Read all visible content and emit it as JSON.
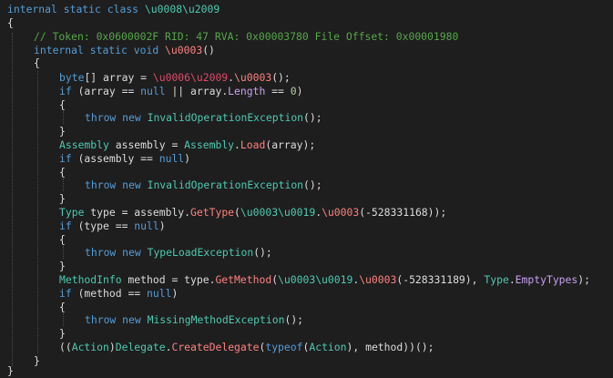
{
  "code": {
    "class_decl": {
      "kw1": "internal",
      "kw2": "static",
      "kw3": "class",
      "name": "\\u0008\\u2009"
    },
    "open_brace_1": "{",
    "comment": "// Token: 0x0600002F RID: 47 RVA: 0x00003780 File Offset: 0x00001980",
    "method_decl": {
      "kw1": "internal",
      "kw2": "static",
      "kw3": "void",
      "name": "\\u0003",
      "parens": "()"
    },
    "open_brace_2": "{",
    "l1": {
      "type": "byte",
      "rest1": "[] array = ",
      "obj": "\\u0006\\u2009",
      "dot": ".",
      "meth": "\\u0003",
      "end": "();"
    },
    "l2": {
      "kw": "if",
      "p1": " (array == ",
      "null": "null",
      "p2": " || array.",
      "prop": "Length",
      "p3": " == ",
      "num": "0",
      "p4": ")"
    },
    "l3": "{",
    "l4": {
      "kw1": "throw",
      "kw2": "new",
      "type": "InvalidOperationException",
      "end": "();"
    },
    "l5": "}",
    "l6": {
      "type1": "Assembly",
      "p1": " assembly = ",
      "type2": "Assembly",
      "dot": ".",
      "meth": "Load",
      "end": "(array);"
    },
    "l7": {
      "kw": "if",
      "p1": " (assembly == ",
      "null": "null",
      "p2": ")"
    },
    "l8": "{",
    "l9": {
      "kw1": "throw",
      "kw2": "new",
      "type": "InvalidOperationException",
      "end": "();"
    },
    "l10": "}",
    "l11": {
      "type1": "Type",
      "p1": " type = assembly.",
      "meth": "GetType",
      "p2": "(",
      "obj": "\\u0003\\u0019",
      "dot": ".",
      "meth2": "\\u0003",
      "end": "(-528331168));"
    },
    "l12": {
      "kw": "if",
      "p1": " (type == ",
      "null": "null",
      "p2": ")"
    },
    "l13": "{",
    "l14": {
      "kw1": "throw",
      "kw2": "new",
      "type": "TypeLoadException",
      "end": "();"
    },
    "l15": "}",
    "l16": {
      "type1": "MethodInfo",
      "p1": " method = type.",
      "meth": "GetMethod",
      "p2": "(",
      "obj": "\\u0003\\u0019",
      "dot": ".",
      "meth2": "\\u0003",
      "p3": "(-528331189), ",
      "type2": "Type",
      "dot2": ".",
      "prop": "EmptyTypes",
      "end": ");"
    },
    "l17": {
      "kw": "if",
      "p1": " (method == ",
      "null": "null",
      "p2": ")"
    },
    "l18": "{",
    "l19": {
      "kw1": "throw",
      "kw2": "new",
      "type": "MissingMethodException",
      "end": "();"
    },
    "l20": "}",
    "l21": {
      "p1": "((",
      "type1": "Action",
      "p2": ")",
      "type2": "Delegate",
      "dot": ".",
      "meth": "CreateDelegate",
      "p3": "(",
      "kw": "typeof",
      "p4": "(",
      "type3": "Action",
      "end": "), method))();"
    },
    "close_brace_2": "}",
    "close_brace_1": "}"
  },
  "colors": {
    "background": "#1e1e1e",
    "keyword": "#569cd6",
    "comment": "#57a64a",
    "type": "#4ec9b0",
    "method": "#ff8080",
    "text": "#dcdcdc"
  }
}
